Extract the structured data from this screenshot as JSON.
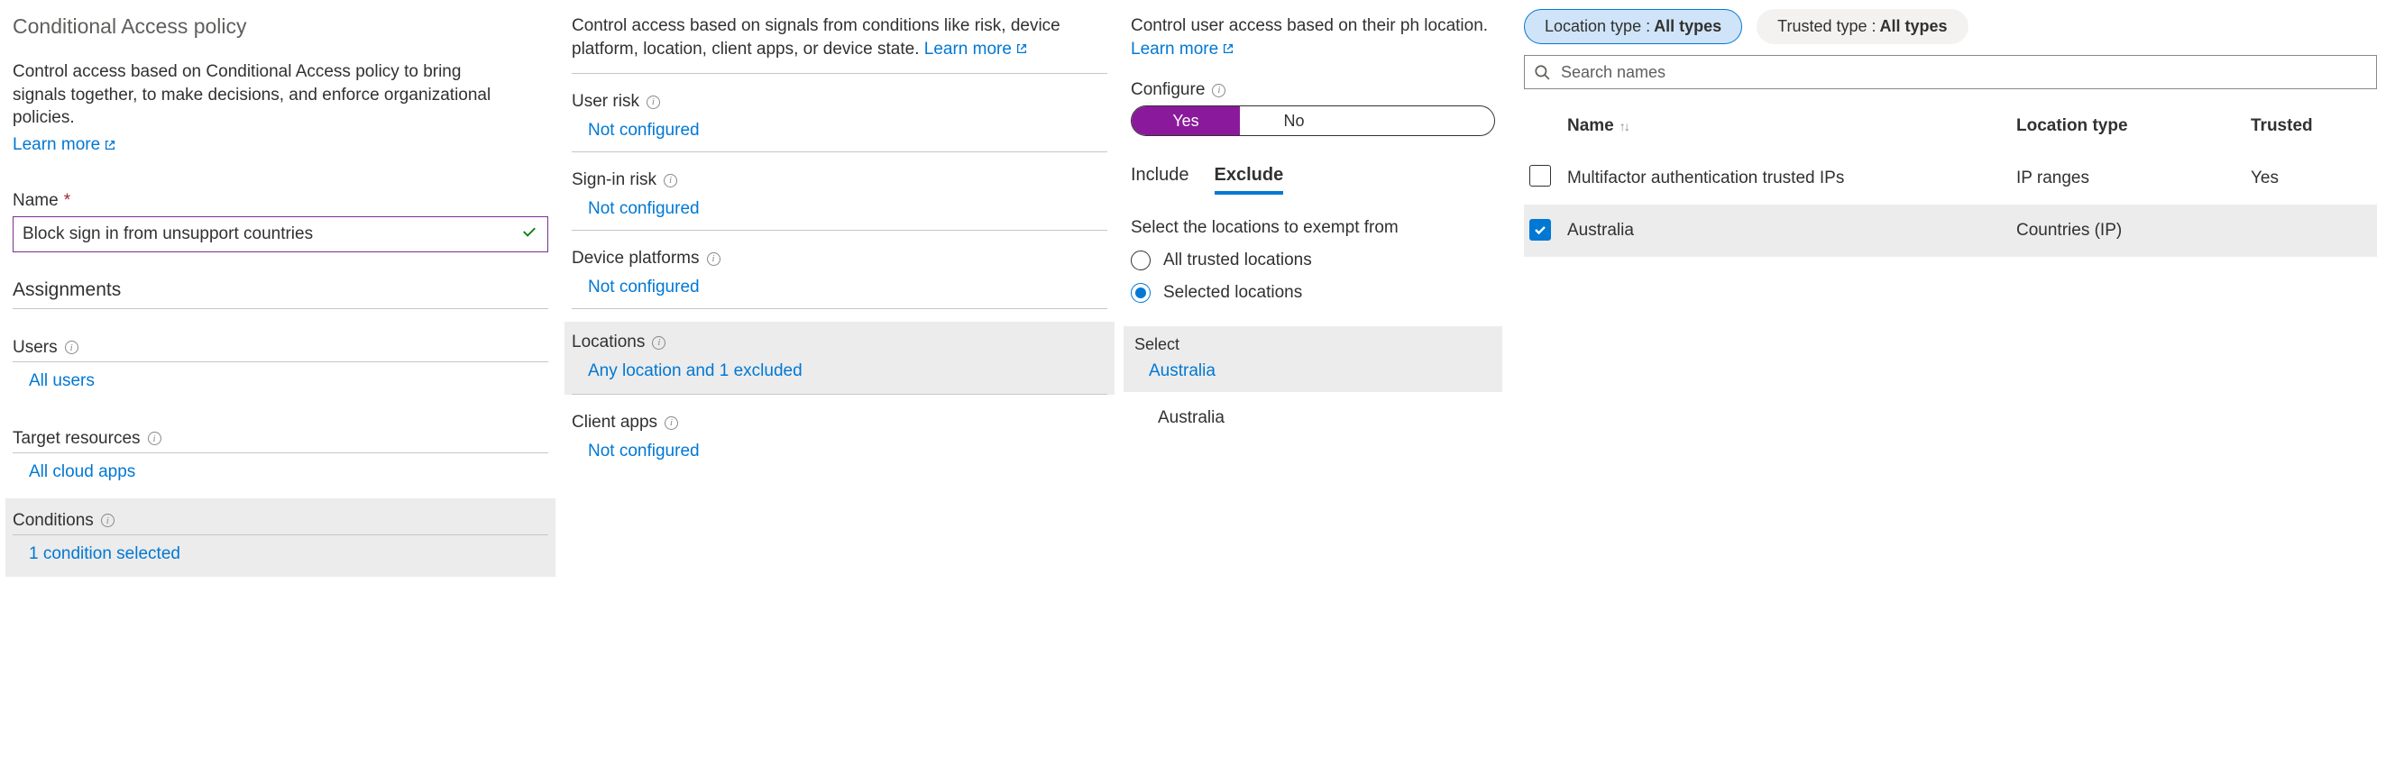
{
  "col1": {
    "page_title": "Conditional Access policy",
    "intro": "Control access based on Conditional Access policy to bring signals together, to make decisions, and enforce organizational policies.",
    "learn_more": "Learn more",
    "name_label": "Name",
    "name_value": "Block sign in from unsupport countries",
    "assignments_title": "Assignments",
    "users": {
      "label": "Users",
      "value": "All users"
    },
    "target": {
      "label": "Target resources",
      "value": "All cloud apps"
    },
    "conditions": {
      "label": "Conditions",
      "value": "1 condition selected"
    }
  },
  "col2": {
    "intro": "Control access based on signals from conditions like risk, device platform, location, client apps, or device state.",
    "learn_more": "Learn more",
    "items": [
      {
        "label": "User risk",
        "value": "Not configured",
        "selected": false
      },
      {
        "label": "Sign-in risk",
        "value": "Not configured",
        "selected": false
      },
      {
        "label": "Device platforms",
        "value": "Not configured",
        "selected": false
      },
      {
        "label": "Locations",
        "value": "Any location and 1 excluded",
        "selected": true
      },
      {
        "label": "Client apps",
        "value": "Not configured",
        "selected": false
      }
    ]
  },
  "col3": {
    "intro": "Control user access based on their ph location.",
    "learn_more": "Learn more",
    "configure_label": "Configure",
    "toggle": {
      "yes": "Yes",
      "no": "No"
    },
    "tabs": {
      "include": "Include",
      "exclude": "Exclude"
    },
    "excl_desc": "Select the locations to exempt from",
    "radios": {
      "all_trusted": "All trusted locations",
      "selected": "Selected locations"
    },
    "select": {
      "title": "Select",
      "value": "Australia"
    },
    "row_value": "Australia"
  },
  "col4": {
    "chip_location_prefix": "Location type : ",
    "chip_location_value": "All types",
    "chip_trusted_prefix": "Trusted type : ",
    "chip_trusted_value": "All types",
    "search_placeholder": "Search names",
    "head": {
      "name": "Name",
      "type": "Location type",
      "trusted": "Trusted"
    },
    "rows": [
      {
        "checked": false,
        "name": "Multifactor authentication trusted IPs",
        "type": "IP ranges",
        "trusted": "Yes"
      },
      {
        "checked": true,
        "name": "Australia",
        "type": "Countries (IP)",
        "trusted": ""
      }
    ]
  }
}
